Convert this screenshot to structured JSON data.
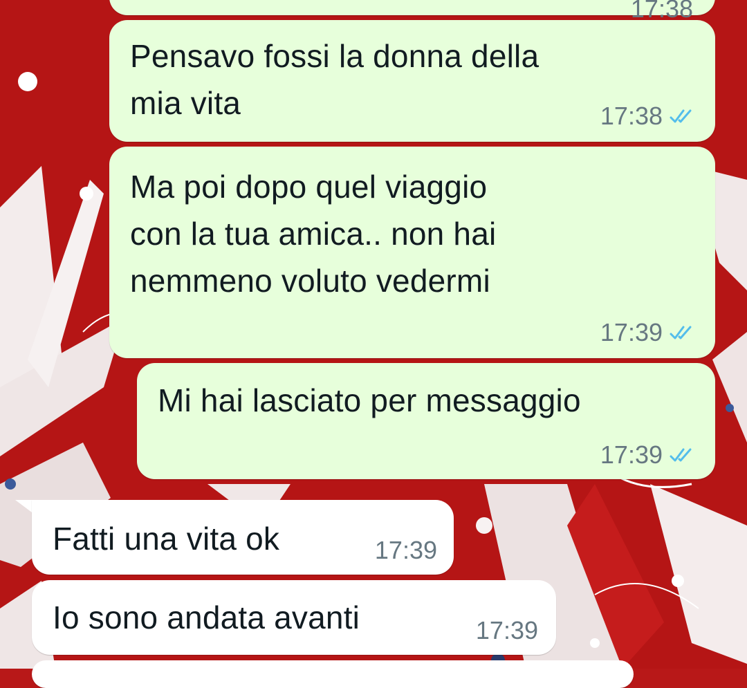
{
  "chat": {
    "messages": [
      {
        "direction": "outgoing",
        "text": "",
        "time": "17:38",
        "status": "read"
      },
      {
        "direction": "outgoing",
        "text": "Pensavo fossi la donna della\nmia vita",
        "time": "17:38",
        "status": "read"
      },
      {
        "direction": "outgoing",
        "text": "Ma poi dopo quel viaggio\ncon la tua amica.. non hai\nnemmeno voluto vedermi",
        "time": "17:39",
        "status": "read"
      },
      {
        "direction": "outgoing",
        "text": "Mi hai lasciato per messaggio",
        "time": "17:39",
        "status": "read"
      },
      {
        "direction": "incoming",
        "text": "Fatti una vita ok",
        "time": "17:39"
      },
      {
        "direction": "incoming",
        "text": "Io sono andata avanti",
        "time": "17:39"
      }
    ]
  },
  "colors": {
    "outgoing_bubble": "#e7ffdb",
    "incoming_bubble": "#ffffff",
    "read_ticks": "#53bdeb",
    "wallpaper_main": "#b81818"
  },
  "icons": {
    "read_receipt": "double-check-icon"
  }
}
